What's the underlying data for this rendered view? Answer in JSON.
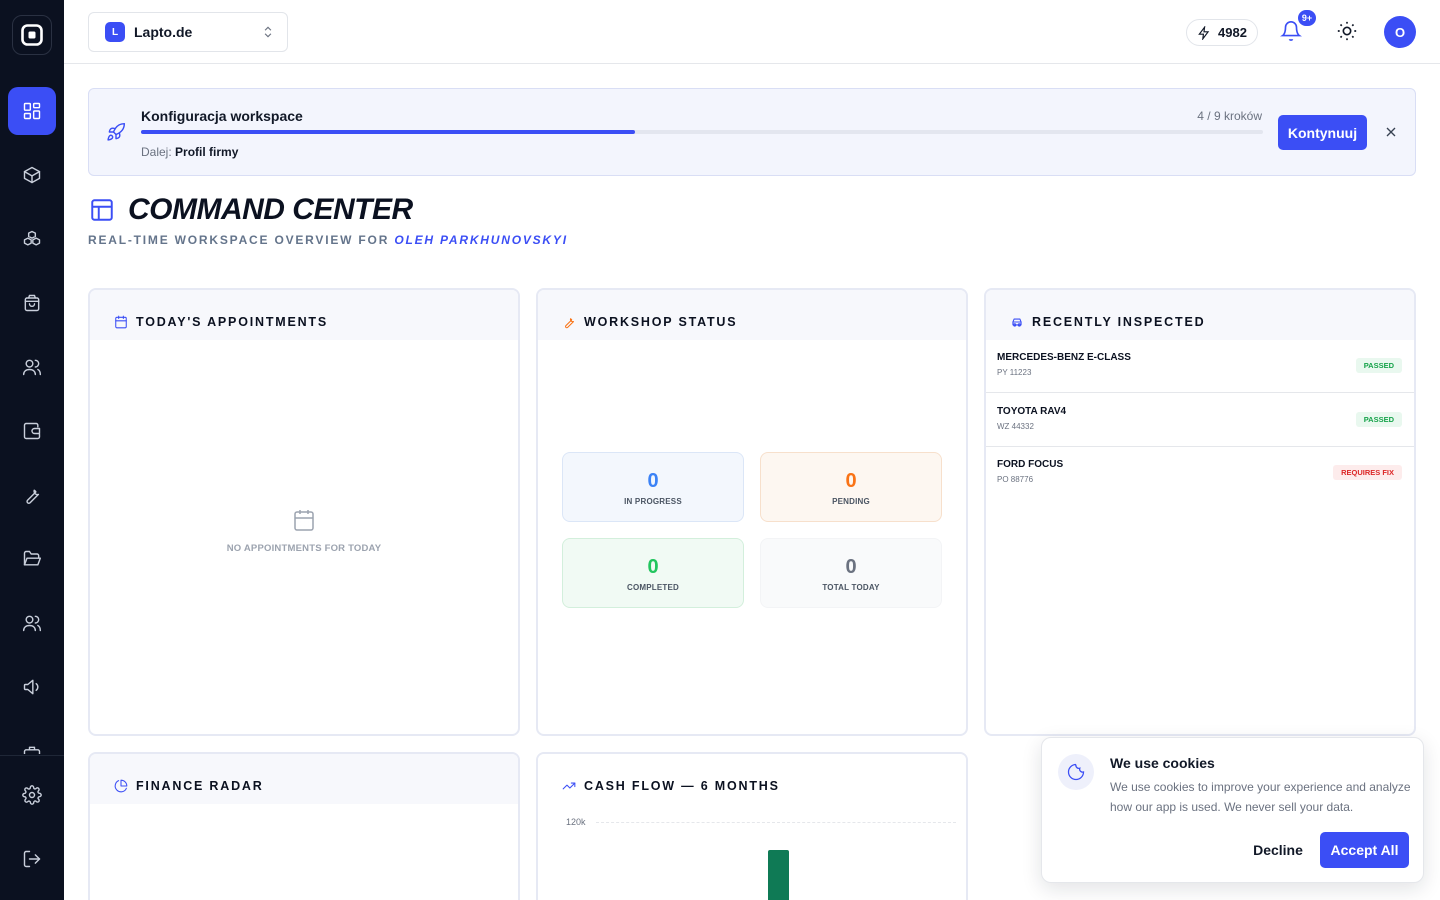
{
  "workspace": {
    "badge": "L",
    "name": "Lapto.de"
  },
  "topbar": {
    "credits": "4982",
    "notifications_badge": "9+",
    "avatar_initial": "O"
  },
  "onboarding": {
    "title": "Konfiguracja workspace",
    "steps": "4 / 9 kroków",
    "progress": 0.44,
    "next_prefix": "Dalej:",
    "next_step": "Profil firmy",
    "continue_label": "Kontynuuj"
  },
  "page": {
    "title": "COMMAND CENTER",
    "subtitle_prefix": "REAL-TIME WORKSPACE OVERVIEW FOR",
    "user_name": "OLEH PARKHUNOVSKYI"
  },
  "appointments": {
    "title": "TODAY'S APPOINTMENTS",
    "empty_text": "NO APPOINTMENTS FOR TODAY"
  },
  "workshop": {
    "title": "WORKSHOP STATUS",
    "stats": [
      {
        "value": "0",
        "label": "IN PROGRESS",
        "color": "#3b82f6"
      },
      {
        "value": "0",
        "label": "PENDING",
        "color": "#f97316"
      },
      {
        "value": "0",
        "label": "COMPLETED",
        "color": "#22c55e"
      },
      {
        "value": "0",
        "label": "TOTAL TODAY",
        "color": "#6b7280"
      }
    ]
  },
  "inspected": {
    "title": "RECENTLY INSPECTED",
    "rows": [
      {
        "name": "MERCEDES-BENZ E-CLASS",
        "plate": "PY 11223",
        "status": "PASSED",
        "status_color": "#16a34a"
      },
      {
        "name": "TOYOTA RAV4",
        "plate": "WZ 44332",
        "status": "PASSED",
        "status_color": "#16a34a"
      },
      {
        "name": "FORD FOCUS",
        "plate": "PO 88776",
        "status": "REQUIRES FIX",
        "status_color": "#dc2626"
      }
    ]
  },
  "finance": {
    "title": "FINANCE RADAR"
  },
  "cashflow": {
    "title": "CASH FLOW — 6 MONTHS",
    "y_tick_top": "120k",
    "bar_color": "#0f7a55"
  },
  "cookie": {
    "title": "We use cookies",
    "text": "We use cookies to improve your experience and analyze how our app is used. We never sell your data.",
    "decline_label": "Decline",
    "accept_label": "Accept All"
  },
  "colors": {
    "accent": "#3b4ef5",
    "sidebar_bg": "#0b1120"
  }
}
